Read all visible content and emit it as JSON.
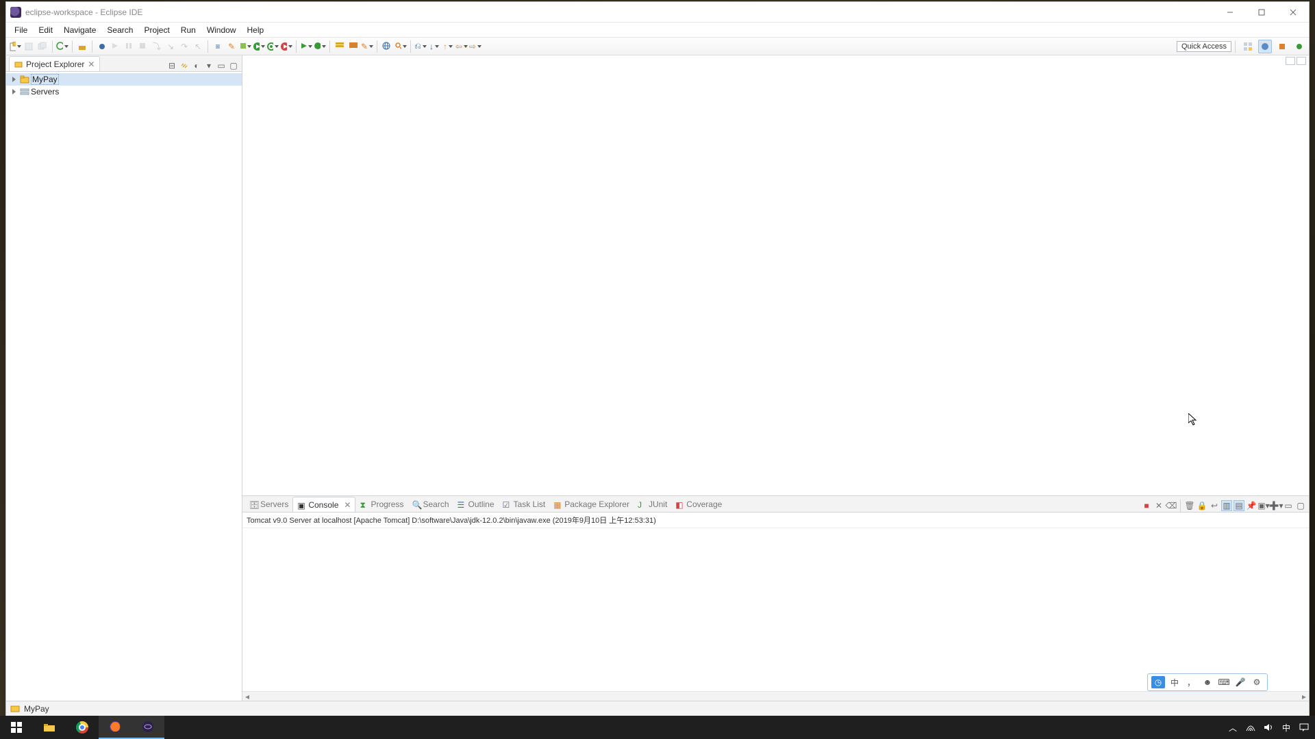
{
  "window": {
    "title": "eclipse-workspace - Eclipse IDE"
  },
  "menubar": [
    {
      "id": "file",
      "label": "File"
    },
    {
      "id": "edit",
      "label": "Edit"
    },
    {
      "id": "navigate",
      "label": "Navigate"
    },
    {
      "id": "search",
      "label": "Search"
    },
    {
      "id": "project",
      "label": "Project"
    },
    {
      "id": "run",
      "label": "Run"
    },
    {
      "id": "window",
      "label": "Window"
    },
    {
      "id": "help",
      "label": "Help"
    }
  ],
  "toolbar": {
    "quick_access": "Quick Access"
  },
  "project_explorer": {
    "title": "Project Explorer",
    "items": [
      {
        "label": "MyPay",
        "icon": "project",
        "selected": true
      },
      {
        "label": "Servers",
        "icon": "servers",
        "selected": false
      }
    ]
  },
  "bottom_tabs": [
    {
      "id": "servers",
      "label": "Servers",
      "active": false
    },
    {
      "id": "console",
      "label": "Console",
      "active": true
    },
    {
      "id": "progress",
      "label": "Progress",
      "active": false
    },
    {
      "id": "search",
      "label": "Search",
      "active": false
    },
    {
      "id": "outline",
      "label": "Outline",
      "active": false
    },
    {
      "id": "tasklist",
      "label": "Task List",
      "active": false
    },
    {
      "id": "pkgexpl",
      "label": "Package Explorer",
      "active": false
    },
    {
      "id": "junit",
      "label": "JUnit",
      "active": false
    },
    {
      "id": "coverage",
      "label": "Coverage",
      "active": false
    }
  ],
  "console": {
    "header": "Tomcat v9.0 Server at localhost [Apache Tomcat] D:\\software\\Java\\jdk-12.0.2\\bin\\javaw.exe (2019年9月10日 上午12:53:31)"
  },
  "statusbar": {
    "project": "MyPay"
  },
  "systray": {
    "ime": "中"
  }
}
